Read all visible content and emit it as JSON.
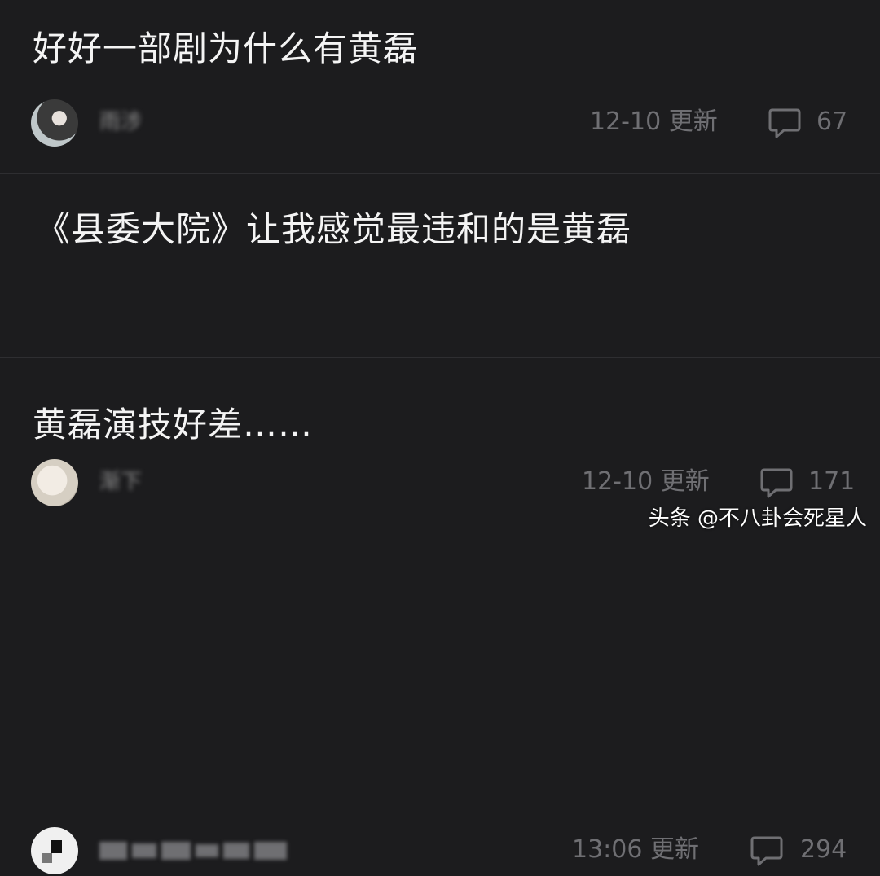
{
  "posts": [
    {
      "title": "好好一部剧为什么有黄磊",
      "username": "雨涉",
      "updated": "12-10 更新",
      "comments": "67",
      "comment_icon": "speech-bubble-icon"
    },
    {
      "title": "《县委大院》让我感觉最违和的是黄磊",
      "username": "渐下",
      "updated": "12-10 更新",
      "comments": "171",
      "comment_icon": "speech-bubble-icon"
    },
    {
      "title": "黄磊演技好差……",
      "username": "",
      "updated": "13:06 更新",
      "comments": "294",
      "comment_icon": "speech-bubble-icon"
    }
  ],
  "watermark": "头条 @不八卦会死星人",
  "colors": {
    "background": "#1c1c1e",
    "title": "#f4f4f4",
    "meta": "#6f6f73",
    "divider": "#2e2e31"
  }
}
